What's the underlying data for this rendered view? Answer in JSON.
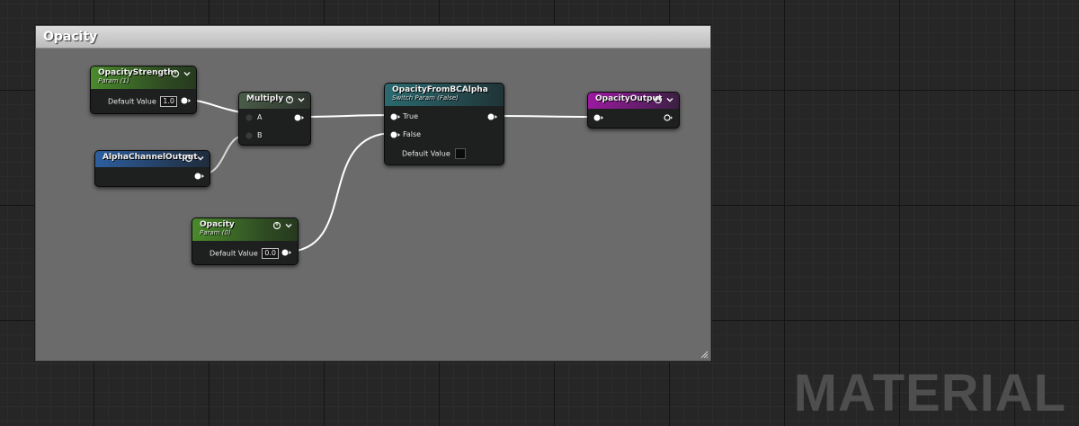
{
  "comment": {
    "title": "Opacity"
  },
  "nodes": {
    "opacity_strength": {
      "title": "OpacityStrength",
      "subtitle": "Param (1)",
      "label": "Default Value",
      "value": "1.0"
    },
    "alpha_channel_output": {
      "title": "AlphaChannelOutput"
    },
    "multiply": {
      "title": "Multiply",
      "pin_a": "A",
      "pin_b": "B"
    },
    "opacity_param": {
      "title": "Opacity",
      "subtitle": "Param (0)",
      "label": "Default Value",
      "value": "0.0"
    },
    "switch": {
      "title": "OpacityFromBCAlpha",
      "subtitle": "Switch Param (False)",
      "pin_true": "True",
      "pin_false": "False",
      "label": "Default Value"
    },
    "opacity_output": {
      "title": "OpacityOutput"
    }
  },
  "watermark": "MATERIAL",
  "colors": {
    "param": "#4a8a2c",
    "function_output": "#2d5f9e",
    "switch": "#2a6a70",
    "output": "#9a1aa0",
    "comment_bg": "#6b6b6b",
    "canvas": "#262626"
  },
  "icons": {
    "preview": "preview-toggle-icon",
    "collapse": "chevron-down-icon",
    "pin": "exec-pin-icon",
    "resize": "resize-grip-icon"
  }
}
